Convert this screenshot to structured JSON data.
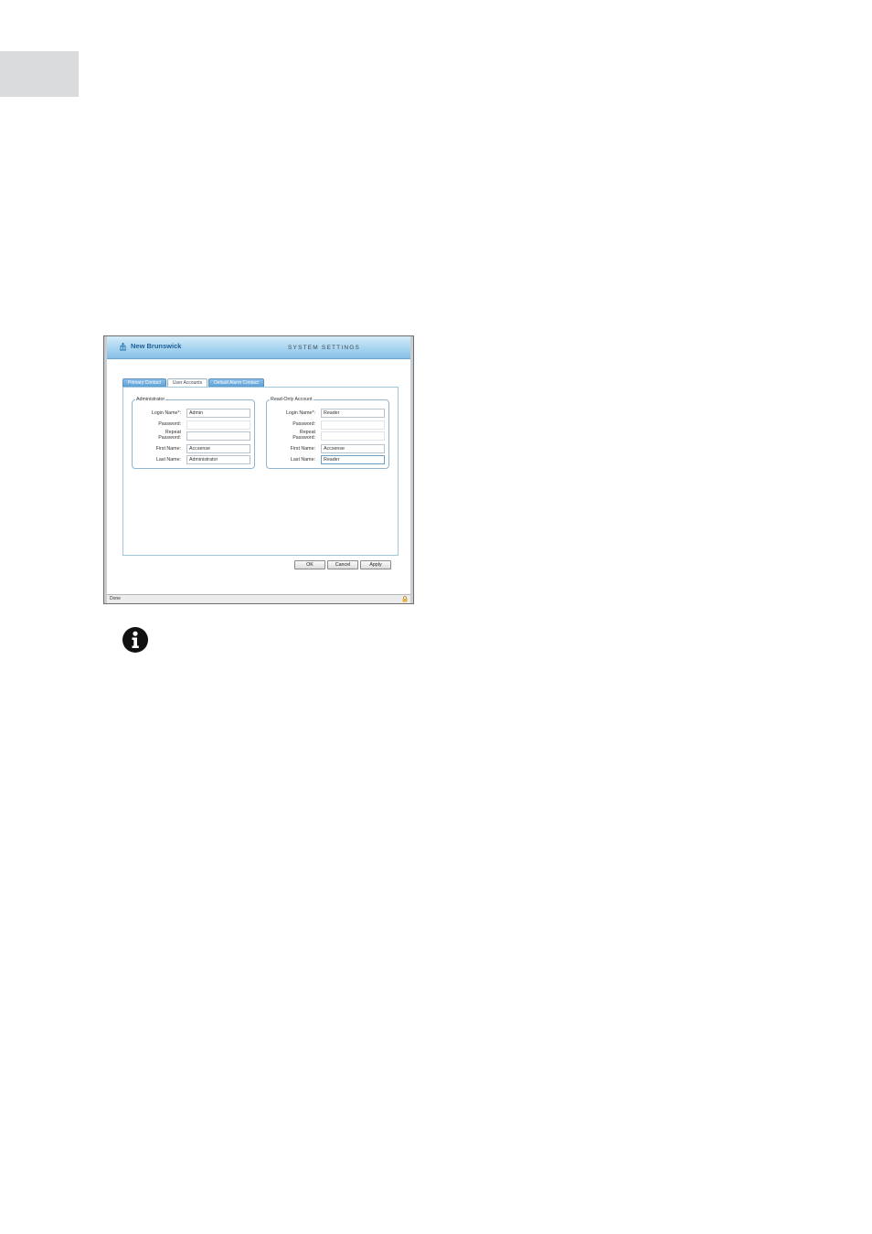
{
  "header": {
    "brand": "New Brunswick",
    "title": "SYSTEM SETTINGS"
  },
  "tabs": [
    {
      "label": "Primary Contact",
      "active": false
    },
    {
      "label": "User Accounts",
      "active": true
    },
    {
      "label": "Default Alarm Contact",
      "active": false
    }
  ],
  "administrator": {
    "legend": "Administrator",
    "login_label": "Login Name*:",
    "login_value": "Admin",
    "password_label": "Password:",
    "password_value": "",
    "repeat_label_1": "Repeat",
    "repeat_label_2": "Password:",
    "repeat_value": "",
    "first_label": "First Name:",
    "first_value": "Accsense",
    "last_label": "Last Name:",
    "last_value": "Administrator"
  },
  "readonly": {
    "legend": "Read-Only Account",
    "login_label": "Login Name*:",
    "login_value": "Reader",
    "password_label": "Password:",
    "password_value": "",
    "repeat_label_1": "Repeat",
    "repeat_label_2": "Password:",
    "repeat_value": "",
    "first_label": "First Name:",
    "first_value": "Accsense",
    "last_label": "Last Name:",
    "last_value": "Reader"
  },
  "buttons": {
    "ok": "OK",
    "cancel": "Cancel",
    "apply": "Apply"
  },
  "status": {
    "text": "Done"
  },
  "icons": {
    "logo": "new-brunswick-logo-icon",
    "lock": "lock-icon",
    "info": "info-icon"
  },
  "colors": {
    "header_blue": "#86c0e6",
    "tab_blue": "#5c9fd5",
    "panel_border": "#9fc7d8",
    "brand_text": "#1f5e94"
  }
}
